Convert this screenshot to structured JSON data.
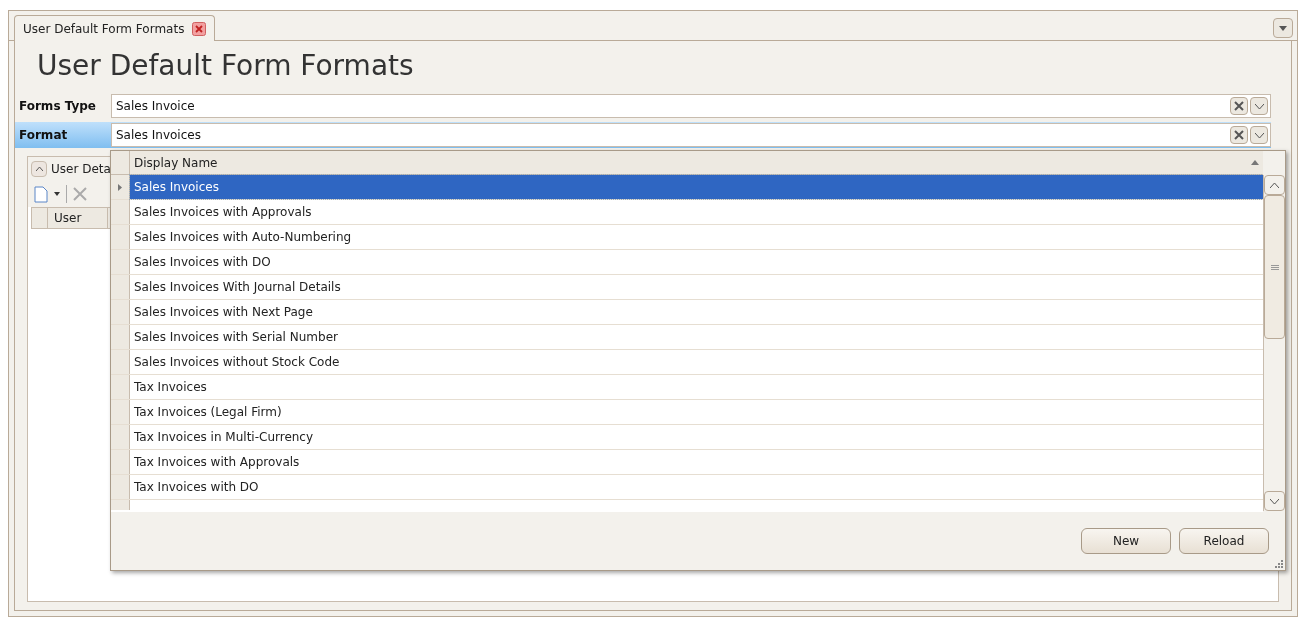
{
  "tabs": [
    {
      "label": "User Default Form Formats",
      "selected": true
    }
  ],
  "title": "User Default Form Formats",
  "fields": [
    {
      "label": "Forms Type",
      "value": "Sales Invoice",
      "focused": false
    },
    {
      "label": "Format",
      "value": "Sales Invoices",
      "focused": true
    }
  ],
  "details_panel": {
    "label": "User Deta",
    "columns": [
      "User"
    ]
  },
  "dropdown": {
    "columns": [
      "Display Name"
    ],
    "rows": [
      {
        "label": "Sales Invoices",
        "selected": true
      },
      {
        "label": "Sales Invoices with Approvals",
        "selected": false
      },
      {
        "label": "Sales Invoices with Auto-Numbering",
        "selected": false
      },
      {
        "label": "Sales Invoices with DO",
        "selected": false
      },
      {
        "label": "Sales Invoices With Journal Details",
        "selected": false
      },
      {
        "label": "Sales Invoices with Next Page",
        "selected": false
      },
      {
        "label": "Sales Invoices with Serial Number",
        "selected": false
      },
      {
        "label": "Sales Invoices without Stock Code",
        "selected": false
      },
      {
        "label": "Tax Invoices",
        "selected": false
      },
      {
        "label": "Tax Invoices (Legal Firm)",
        "selected": false
      },
      {
        "label": "Tax Invoices in Multi-Currency",
        "selected": false
      },
      {
        "label": "Tax Invoices with Approvals",
        "selected": false
      },
      {
        "label": "Tax Invoices with DO",
        "selected": false
      }
    ],
    "buttons": [
      "New",
      "Reload"
    ]
  }
}
